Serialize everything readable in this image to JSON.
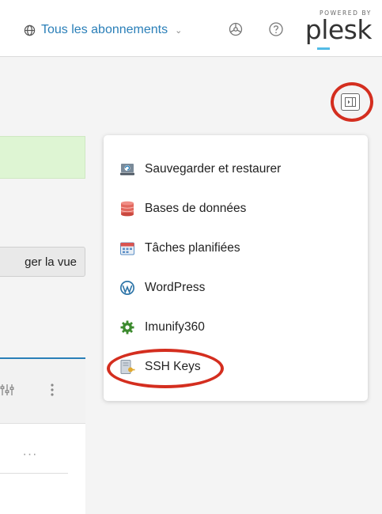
{
  "header": {
    "subscriptions_label": "Tous les abonnements",
    "brand_powered": "POWERED BY",
    "brand_name": "plesk"
  },
  "left": {
    "view_button_label": "ger la vue",
    "row_more": "···"
  },
  "menu": {
    "items": [
      {
        "label": "Sauvegarder et restaurer",
        "icon": "backup-icon"
      },
      {
        "label": "Bases de données",
        "icon": "database-icon"
      },
      {
        "label": "Tâches planifiées",
        "icon": "calendar-icon"
      },
      {
        "label": "WordPress",
        "icon": "wordpress-icon"
      },
      {
        "label": "Imunify360",
        "icon": "gear-icon"
      },
      {
        "label": "SSH Keys",
        "icon": "ssh-key-icon"
      }
    ]
  },
  "colors": {
    "link": "#2a7fb8",
    "highlight_ring": "#d42e1f",
    "banner_green": "#def5d3",
    "brand_accent": "#52bbe6"
  }
}
